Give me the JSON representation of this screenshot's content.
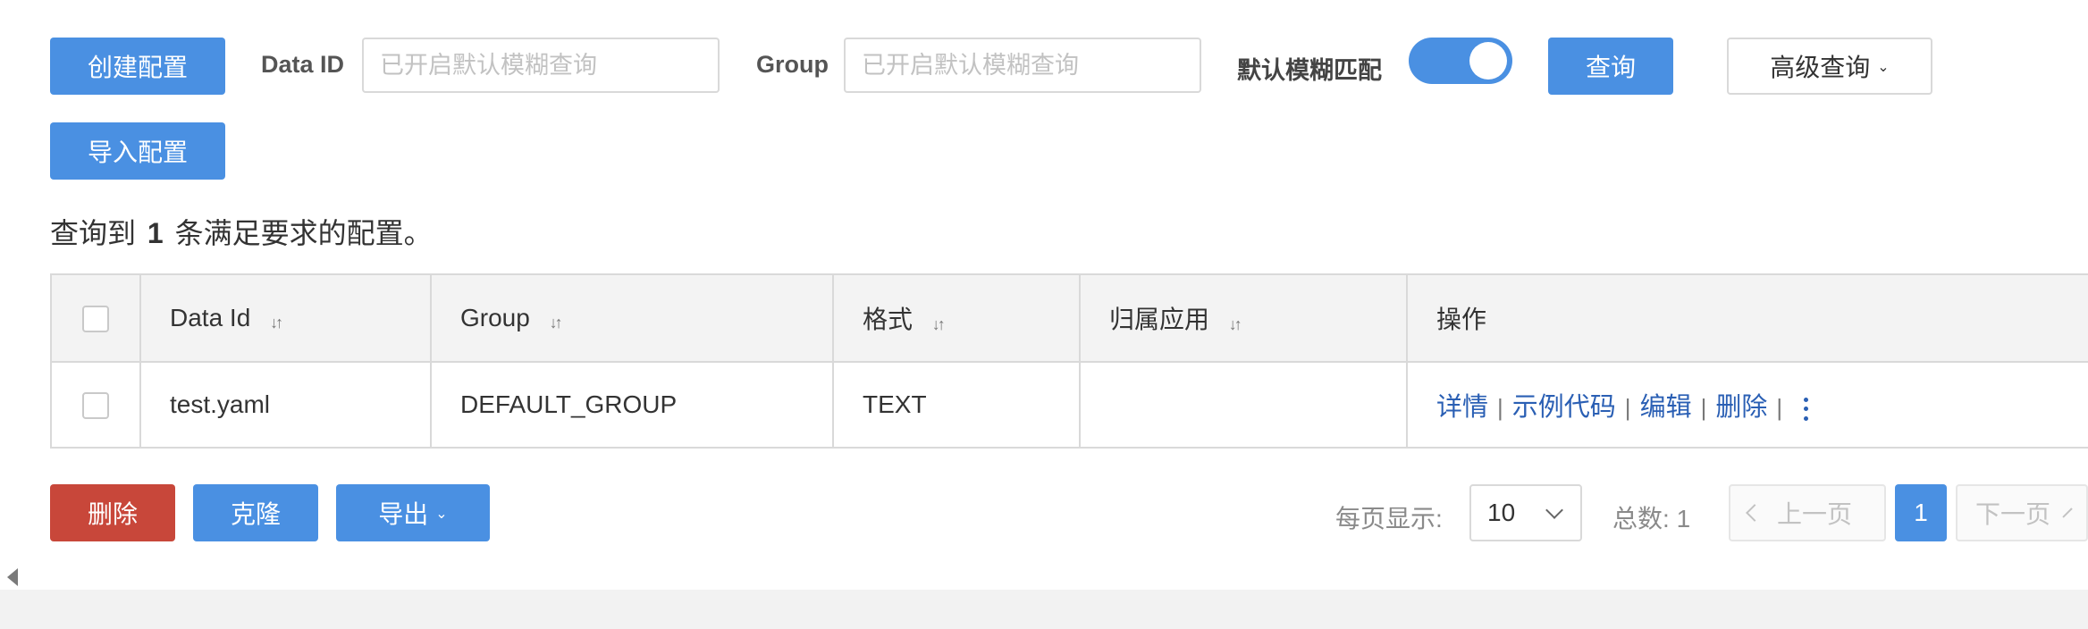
{
  "colors": {
    "primary": "#4a90e2",
    "danger": "#c8473a",
    "link": "#2a5fb4"
  },
  "toolbar": {
    "create_label": "创建配置",
    "import_label": "导入配置",
    "data_id_label": "Data ID",
    "data_id_placeholder": "已开启默认模糊查询",
    "group_label": "Group",
    "group_placeholder": "已开启默认模糊查询",
    "fuzzy_label": "默认模糊匹配",
    "fuzzy_enabled": true,
    "search_label": "查询",
    "advanced_label": "高级查询",
    "advanced_icon": "chevron-down-icon"
  },
  "summary": {
    "prefix": "查询到",
    "count": "1",
    "suffix": "条满足要求的配置。"
  },
  "table": {
    "columns": {
      "data_id": "Data Id",
      "group": "Group",
      "format": "格式",
      "app": "归属应用",
      "ops": "操作"
    },
    "sort_icon": "sort-icon",
    "rows": [
      {
        "data_id": "test.yaml",
        "group": "DEFAULT_GROUP",
        "format": "TEXT",
        "app": "",
        "actions": {
          "detail": "详情",
          "sample": "示例代码",
          "edit": "编辑",
          "delete": "删除"
        },
        "separator": "|",
        "more_icon": "kebab-menu-icon"
      }
    ]
  },
  "bulk": {
    "delete_label": "删除",
    "clone_label": "克隆",
    "export_label": "导出"
  },
  "pagination": {
    "page_size_label": "每页显示:",
    "page_size": "10",
    "total_label": "总数:",
    "total": "1",
    "prev_label": "上一页",
    "current_page": "1",
    "next_label": "下一页"
  }
}
